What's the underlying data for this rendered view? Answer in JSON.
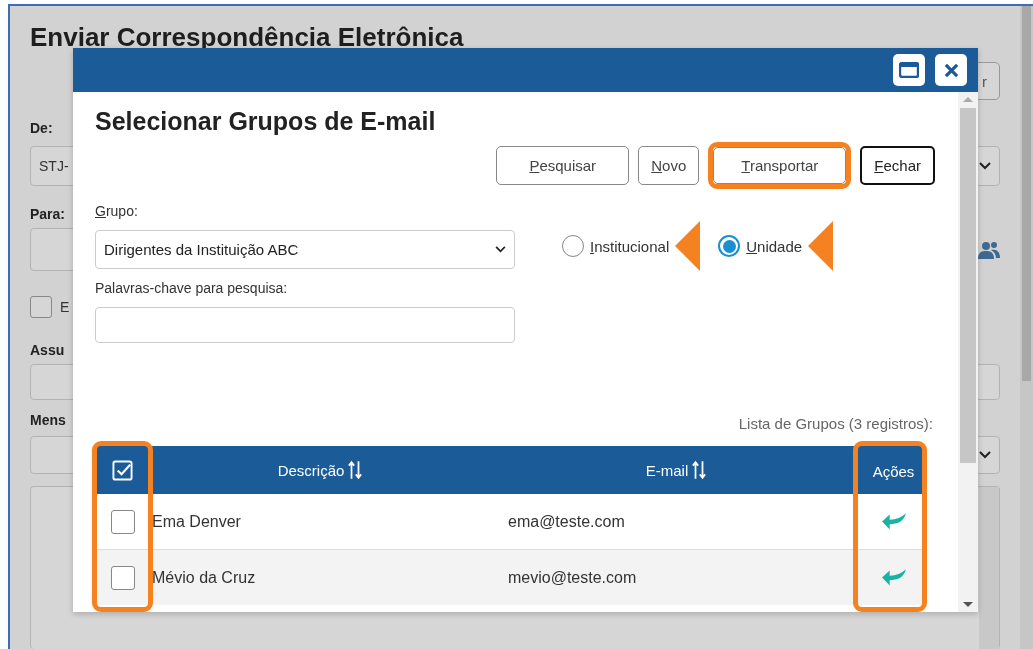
{
  "background_form": {
    "title": "Enviar Correspondência Eletrônica",
    "button_fragment": "r",
    "from_label": "De:",
    "from_value": "STJ-",
    "to_label": "Para:",
    "checkbox_label": "E",
    "checkbox_checked": false,
    "subject_label": "Assu",
    "message_label": "Mens"
  },
  "dialog": {
    "title": "Selecionar Grupos de E-mail",
    "buttons": [
      {
        "label": "Pesquisar",
        "focused": false,
        "highlighted": false
      },
      {
        "label": "Novo",
        "focused": false,
        "highlighted": false
      },
      {
        "label": "Transportar",
        "focused": false,
        "highlighted": true
      },
      {
        "label": "Fechar",
        "focused": true,
        "highlighted": false
      }
    ],
    "group": {
      "label": "Grupo:",
      "value": "Dirigentes da Instituição ABC"
    },
    "keywords": {
      "label": "Palavras-chave para pesquisa:"
    },
    "scope_options": [
      {
        "label": "Institucional",
        "selected": false,
        "pointed": true
      },
      {
        "label": "Unidade",
        "selected": true,
        "pointed": true
      }
    ],
    "list_caption": "Lista de Grupos (3 registros):",
    "table": {
      "checkbox_column_highlighted": true,
      "columns": [
        {
          "label": "Descrição",
          "sortable": true,
          "highlighted": false
        },
        {
          "label": "E-mail",
          "sortable": true,
          "highlighted": false
        },
        {
          "label": "Ações",
          "sortable": false,
          "highlighted": true
        }
      ],
      "rows": [
        {
          "description": "Ema Denver",
          "email": "ema@teste.com",
          "checked": false
        },
        {
          "description": "Mévio da Cruz",
          "email": "mevio@teste.com",
          "checked": false
        }
      ]
    }
  }
}
